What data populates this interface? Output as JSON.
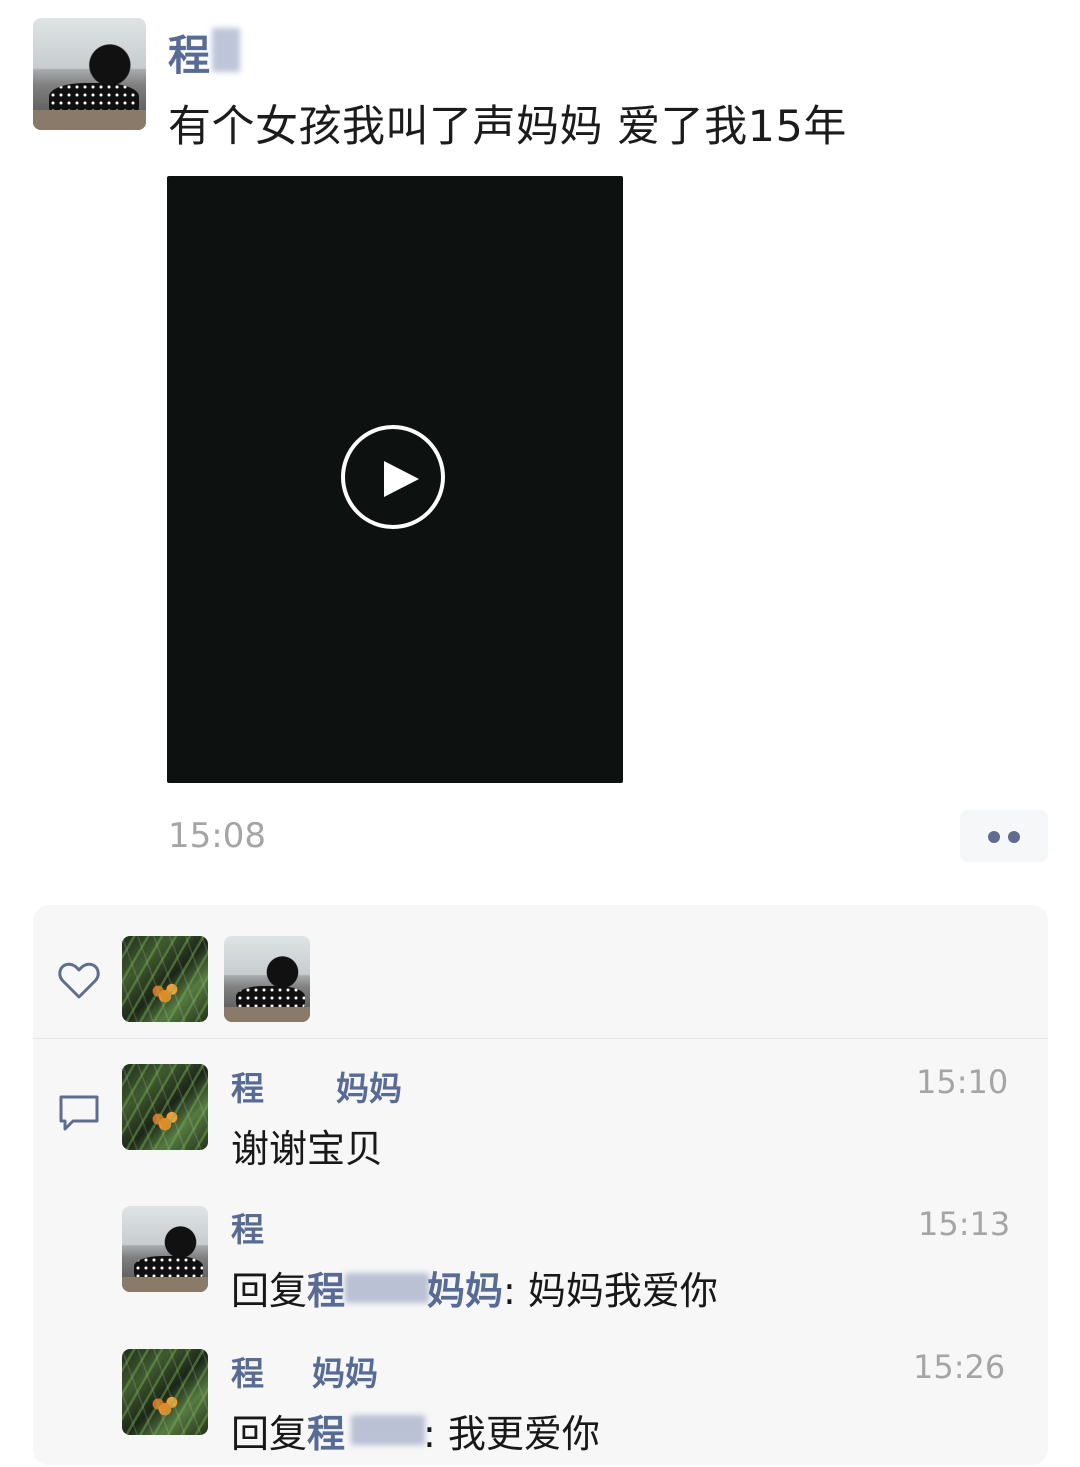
{
  "post": {
    "author_name": "程",
    "text": "有个女孩我叫了声妈妈 爱了我15年",
    "time": "15:08"
  },
  "likes": {
    "icon": "heart-icon"
  },
  "comments": [
    {
      "name": "程",
      "name_suffix": "妈妈",
      "time": "15:10",
      "text": "谢谢宝贝"
    },
    {
      "name": "程",
      "time": "15:13",
      "reply_prefix": "回复",
      "reply_name_visible_start": "程",
      "reply_name_visible_end": "妈妈",
      "reply_text": ": 妈妈我爱你"
    },
    {
      "name": "程",
      "name_suffix": "妈妈",
      "time": "15:26",
      "reply_prefix": "回复",
      "reply_name_visible_start": "程",
      "reply_text": ": 我更爱你"
    }
  ],
  "colors": {
    "name": "#576b95",
    "time": "#a5a5a5",
    "panel_bg": "#f7f7f7",
    "video_bg": "#0d1210"
  },
  "icons": {
    "comment": "comment-bubble-icon",
    "more": "more-dots-icon",
    "play": "play-icon"
  }
}
